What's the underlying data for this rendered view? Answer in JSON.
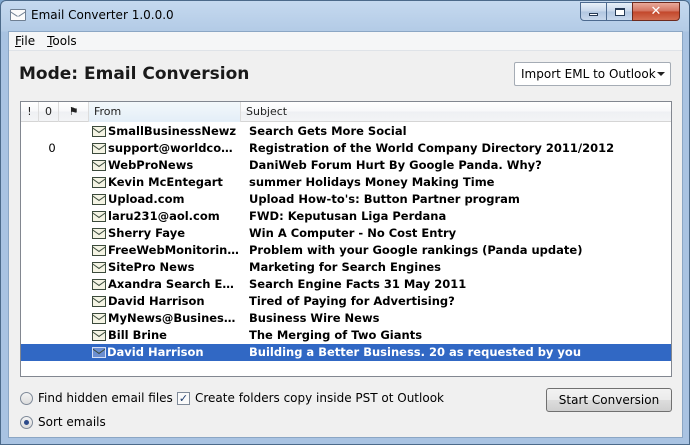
{
  "window": {
    "title": "Email Converter 1.0.0.0",
    "controls": {
      "minimize": "–",
      "maximize": "□",
      "close": "✕"
    }
  },
  "menu": [
    {
      "label": "File",
      "underline": "F",
      "rest": "ile"
    },
    {
      "label": "Tools",
      "underline": "T",
      "rest": "ools"
    }
  ],
  "mode_title": "Mode: Email Conversion",
  "mode_select": {
    "value": "Import EML to Outlook"
  },
  "list": {
    "headers": {
      "importance": "!",
      "attachment": "0",
      "flag": "⚑",
      "from": "From",
      "subject": "Subject"
    },
    "rows": [
      {
        "attachment": "",
        "from": "SmallBusinessNewz",
        "subject": "Search Gets More Social",
        "selected": false
      },
      {
        "attachment": "0",
        "from": "support@worldcomp...",
        "subject": "Registration of the World Company Directory 2011/2012",
        "selected": false
      },
      {
        "attachment": "",
        "from": "WebProNews",
        "subject": "DaniWeb Forum Hurt By Google Panda. Why?",
        "selected": false
      },
      {
        "attachment": "",
        "from": "Kevin McEntegart",
        "subject": "summer Holidays Money Making Time",
        "selected": false
      },
      {
        "attachment": "",
        "from": "Upload.com",
        "subject": "Upload How-to's: Button Partner program",
        "selected": false
      },
      {
        "attachment": "",
        "from": "laru231@aol.com",
        "subject": "FWD: Keputusan Liga Perdana",
        "selected": false
      },
      {
        "attachment": "",
        "from": "Sherry Faye",
        "subject": "Win A Computer - No Cost Entry",
        "selected": false
      },
      {
        "attachment": "",
        "from": "FreeWebMonitoring S...",
        "subject": "Problem with your Google rankings (Panda update)",
        "selected": false
      },
      {
        "attachment": "",
        "from": "SitePro News",
        "subject": "Marketing for Search Engines",
        "selected": false
      },
      {
        "attachment": "",
        "from": "Axandra Search Engi...",
        "subject": "Search Engine Facts 31 May 2011",
        "selected": false
      },
      {
        "attachment": "",
        "from": "David Harrison",
        "subject": "Tired of Paying for Advertising?",
        "selected": false
      },
      {
        "attachment": "",
        "from": "MyNews@BusinessWi...",
        "subject": "Business Wire News",
        "selected": false
      },
      {
        "attachment": "",
        "from": "Bill Brine",
        "subject": "The Merging of Two Giants",
        "selected": false
      },
      {
        "attachment": "",
        "from": "David Harrison",
        "subject": "Building a Better Business. 20 as requested by you",
        "selected": true
      }
    ]
  },
  "options": {
    "find_hidden": {
      "label": "Find hidden email files",
      "checked": false
    },
    "sort_emails": {
      "label": "Sort emails",
      "checked": true
    },
    "create_folders": {
      "label": "Create folders copy inside PST ot Outlook",
      "checked": true
    }
  },
  "start_button": "Start Conversion"
}
